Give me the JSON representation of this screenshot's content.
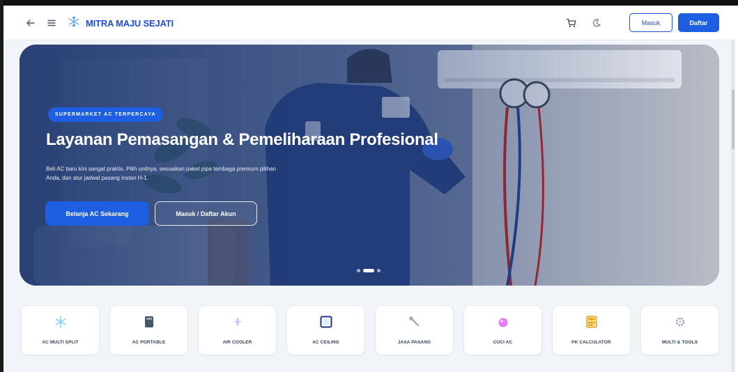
{
  "header": {
    "brand": "MITRA MAJU SEJATI",
    "login_label": "Masuk",
    "register_label": "Daftar"
  },
  "hero": {
    "badge": "SUPERMARKET AC TERPERCAYA",
    "title": "Layanan Pemasangan & Pemeliharaan Profesional",
    "description": "Beli AC baru kini sangat praktis. Pilih unitnya, sesuaikan paket pipa tembaga premium pilihan Anda, dan atur jadwal pasang instan H-1.",
    "primary_button": "Belanja AC Sekarang",
    "secondary_button": "Masuk / Daftar Akun",
    "slides": 3,
    "active_slide": 2
  },
  "categories": [
    {
      "label": "AC MULTI SPLIT",
      "icon": "snowflake-icon"
    },
    {
      "label": "AC PORTABLE",
      "icon": "portable-ac-icon"
    },
    {
      "label": "AIR COOLER",
      "icon": "air-cooler-icon"
    },
    {
      "label": "AC CEILING",
      "icon": "ceiling-ac-icon"
    },
    {
      "label": "JASA PASANG",
      "icon": "wrench-icon"
    },
    {
      "label": "CUCI AC",
      "icon": "cleaning-icon"
    },
    {
      "label": "PK CALCULATOR",
      "icon": "calculator-icon"
    },
    {
      "label": "MULTI & TOOLS",
      "icon": "tools-icon"
    }
  ],
  "colors": {
    "primary": "#1d5fe0",
    "brand_text": "#1d4ed8",
    "page_bg": "#f1f5f9"
  }
}
